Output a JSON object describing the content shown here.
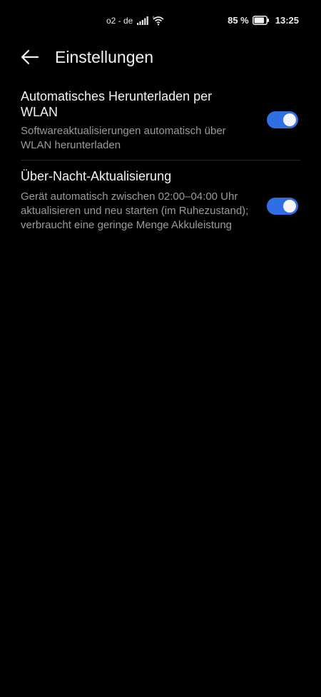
{
  "status_bar": {
    "carrier": "o2 - de",
    "battery_percent": "85 %",
    "battery_level": 0.85,
    "time": "13:25",
    "icons": [
      "signal-icon",
      "wifi-icon",
      "battery-icon"
    ]
  },
  "header": {
    "back_icon": "arrow-left-icon",
    "title": "Einstellungen"
  },
  "settings": [
    {
      "title": "Automatisches Herunterladen per WLAN",
      "description": "Softwareaktualisierungen automatisch über WLAN herunterladen",
      "enabled": true
    },
    {
      "title": "Über-Nacht-Aktualisierung",
      "description": "Gerät automatisch zwischen 02:00–04:00 Uhr aktualisieren und neu starten (im Ruhezustand); verbraucht eine geringe Menge Akkuleistung",
      "enabled": true
    }
  ],
  "colors": {
    "background": "#000000",
    "accent": "#2f6ee3",
    "primary_text": "#f2f2f2",
    "secondary_text": "#9a9a9a"
  }
}
